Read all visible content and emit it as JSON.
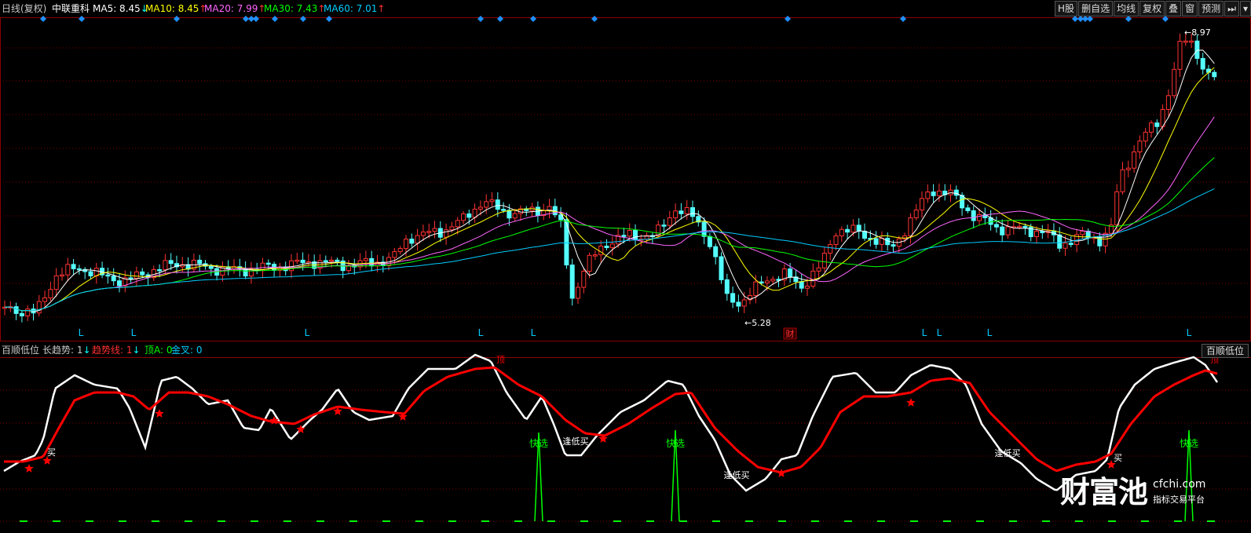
{
  "header": {
    "period_label": "日线(复权)",
    "stock_name": "中联重科",
    "ma": [
      {
        "label": "MA5: 8.45",
        "arrow": "↓",
        "color": "#ffffff",
        "arrow_color": "#00ffff"
      },
      {
        "label": "MA10: 8.45",
        "arrow": "↑",
        "color": "#ffff00",
        "arrow_color": "#ff3030"
      },
      {
        "label": "MA20: 7.99",
        "arrow": "↑",
        "color": "#ff66ff",
        "arrow_color": "#ff3030"
      },
      {
        "label": "MA30: 7.43",
        "arrow": "↑",
        "color": "#00ff00",
        "arrow_color": "#ff3030"
      },
      {
        "label": "MA60: 7.01",
        "arrow": "↑",
        "color": "#00ccff",
        "arrow_color": "#ff3030"
      }
    ]
  },
  "toolbar": {
    "items": [
      "H股",
      "删自选",
      "均线",
      "复权",
      "叠",
      "窗",
      "预测",
      "⏭",
      "▾"
    ]
  },
  "main_chart": {
    "high_label": "8.97",
    "low_label": "5.28",
    "finance_marker": "财",
    "l_marker": "L"
  },
  "sub_header": {
    "title": "百顺低位",
    "trend_label": "长趋势: 1",
    "trend_arrow": "↓",
    "trend_line_label": "趋势线: 1",
    "trend_line_arrow": "↓",
    "top_label": "顶A: 0",
    "cross_label": "金叉: 0",
    "button_label": "百顺低位"
  },
  "sub_chart": {
    "labels": {
      "buy": "买",
      "top": "顶",
      "quick": "快选",
      "low_buy": "逢低买"
    }
  },
  "watermark": {
    "logo": "财富池",
    "domain": "cfchi.com",
    "subtitle": "指标交易平台"
  },
  "colors": {
    "up": "#ff3232",
    "down": "#54ffff",
    "ma5": "#ffffff",
    "ma10": "#ffff00",
    "ma20": "#ff66ff",
    "ma30": "#00ff00",
    "ma60": "#00ccff",
    "trend": "#ff0000",
    "quick": "#00ff00"
  }
}
